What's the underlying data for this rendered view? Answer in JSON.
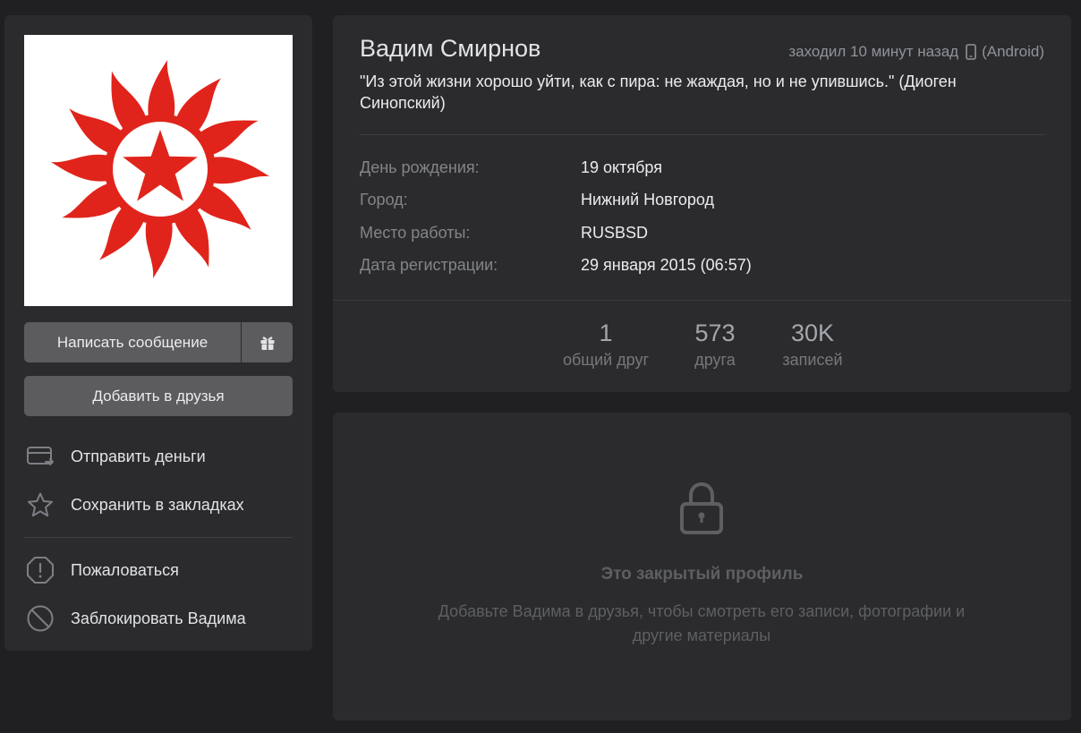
{
  "profile": {
    "name": "Вадим Смирнов",
    "online": "заходил 10 минут назад",
    "platform": "(Android)",
    "status": "\"Из этой жизни хорошо уйти, как с пира: не жаждая, но и не упившись.\" (Диоген Синопский)",
    "info": [
      {
        "key": "День рождения:",
        "value": "19 октября"
      },
      {
        "key": "Город:",
        "value": "Нижний Новгород"
      },
      {
        "key": "Место работы:",
        "value": "RUSBSD"
      },
      {
        "key": "Дата регистрации:",
        "value": "29 января 2015 (06:57)"
      }
    ],
    "counters": [
      {
        "num": "1",
        "label": "общий друг"
      },
      {
        "num": "573",
        "label": "друга"
      },
      {
        "num": "30K",
        "label": "записей"
      }
    ]
  },
  "actions": {
    "message_label": "Написать сообщение",
    "add_friend_label": "Добавить в друзья",
    "menu": [
      {
        "label": "Отправить деньги",
        "icon": "money-transfer-icon"
      },
      {
        "label": "Сохранить в закладках",
        "icon": "star-icon"
      },
      {
        "label": "Пожаловаться",
        "icon": "report-icon"
      },
      {
        "label": "Заблокировать Вадима",
        "icon": "block-icon"
      }
    ]
  },
  "closed": {
    "title": "Это закрытый профиль",
    "text": "Добавьте Вадима в друзья, чтобы смотреть его записи, фотографии и другие материалы"
  },
  "colors": {
    "background": "#202023",
    "card": "#2b2b2e",
    "button": "#5c5c5f",
    "avatar_red": "#e0241b"
  }
}
